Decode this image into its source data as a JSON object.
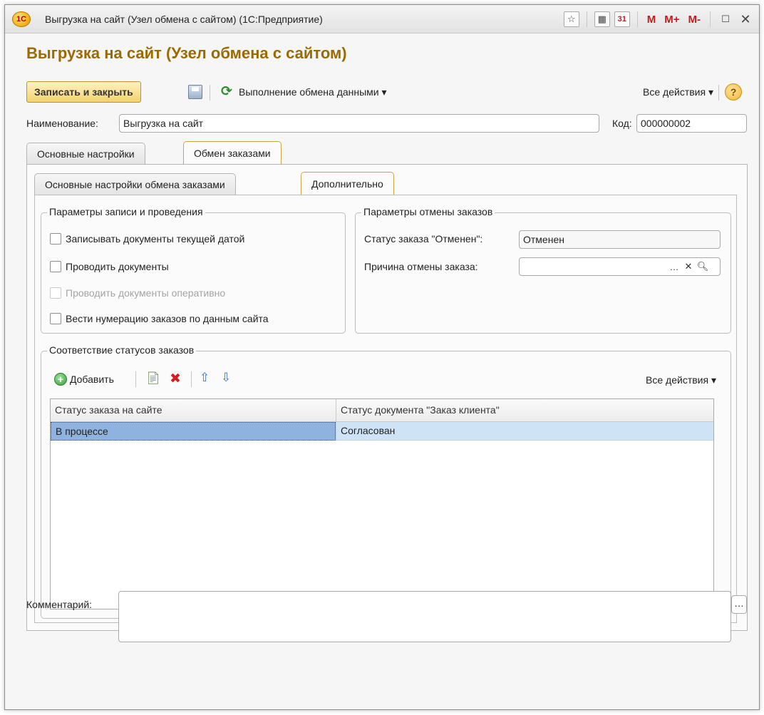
{
  "window": {
    "title": "Выгрузка на сайт (Узел обмена с сайтом)  (1С:Предприятие)",
    "logo_text": "1С",
    "memory_buttons": [
      "M",
      "M+",
      "M-"
    ]
  },
  "form": {
    "title": "Выгрузка на сайт (Узел обмена с сайтом)"
  },
  "toolbar": {
    "save_close_label": "Записать и закрыть",
    "exchange_label": "Выполнение обмена данными ▾",
    "all_actions_label": "Все действия ▾",
    "help_label": "?"
  },
  "fields": {
    "name_label": "Наименование:",
    "name_value": "Выгрузка на сайт",
    "code_label": "Код:",
    "code_value": "000000002",
    "comment_label": "Комментарий:",
    "comment_value": ""
  },
  "tabs": {
    "outer": [
      "Основные настройки",
      "Обмен заказами"
    ],
    "inner": [
      "Основные настройки обмена заказами",
      "Дополнительно"
    ]
  },
  "record_group": {
    "title": "Параметры записи и проведения",
    "options": [
      {
        "label": "Записывать документы текущей датой",
        "checked": false,
        "disabled": false
      },
      {
        "label": "Проводить документы",
        "checked": false,
        "disabled": false
      },
      {
        "label": "Проводить документы оперативно",
        "checked": false,
        "disabled": true
      },
      {
        "label": "Вести нумерацию заказов по данным сайта",
        "checked": false,
        "disabled": false
      }
    ]
  },
  "cancel_group": {
    "title": "Параметры отмены заказов",
    "status_label": "Статус заказа \"Отменен\":",
    "status_value": "Отменен",
    "reason_label": "Причина отмены заказа:",
    "reason_value": ""
  },
  "statuses_group": {
    "title": "Соответствие статусов заказов",
    "add_label": "Добавить",
    "all_actions_label": "Все действия ▾",
    "columns": [
      "Статус заказа на сайте",
      "Статус документа \"Заказ клиента\""
    ],
    "rows": [
      {
        "site_status": "В процессе",
        "doc_status": "Согласован"
      }
    ]
  }
}
